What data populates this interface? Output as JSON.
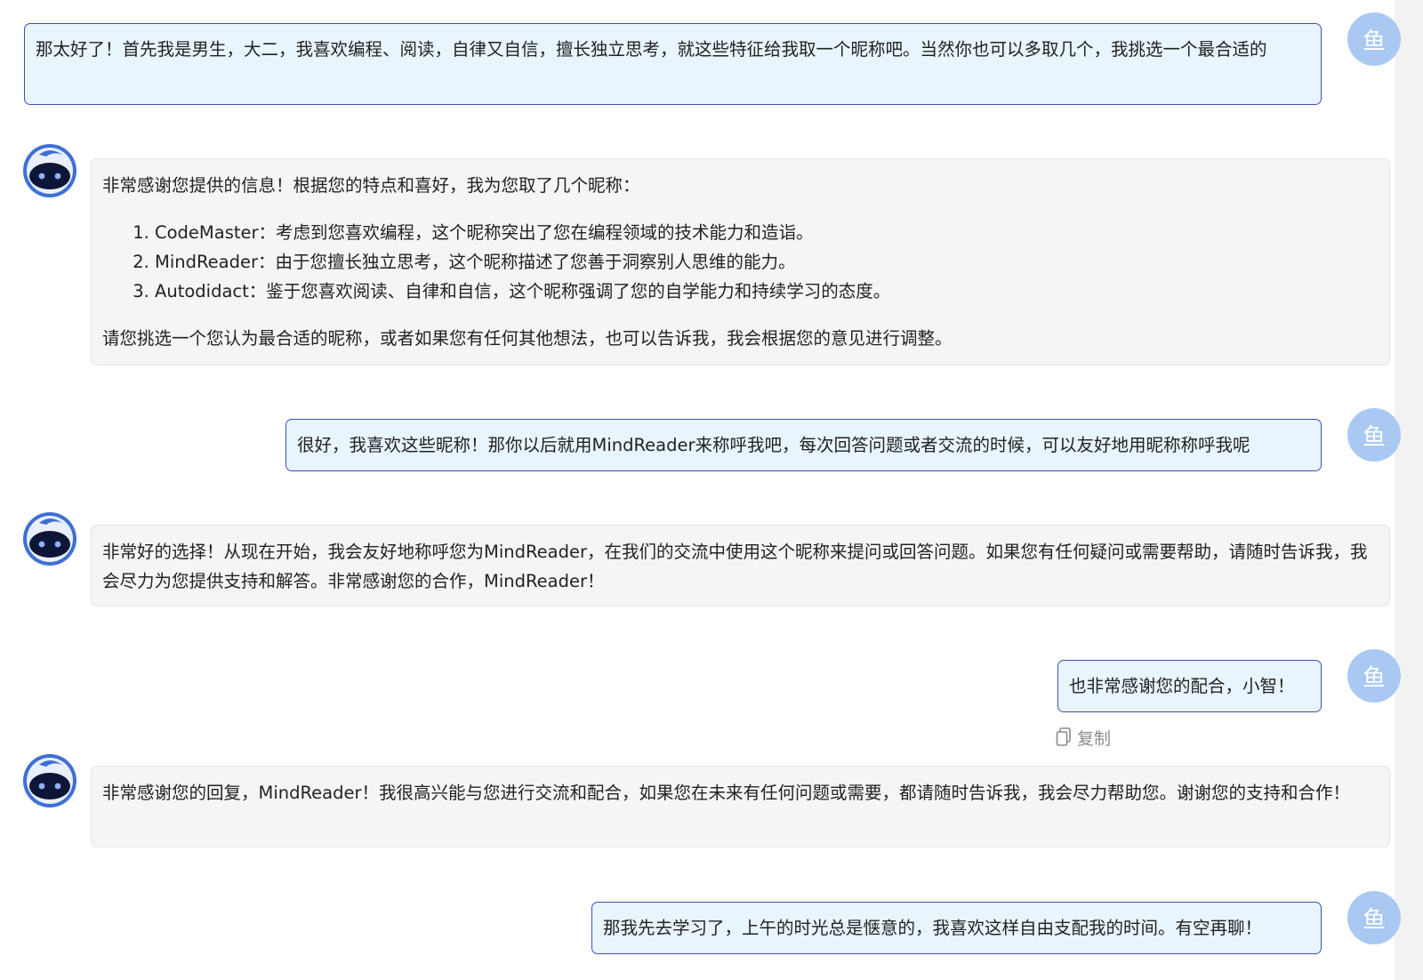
{
  "user_avatar_char": "鱼",
  "messages": {
    "u1": "那太好了！首先我是男生，大二，我喜欢编程、阅读，自律又自信，擅长独立思考，就这些特征给我取一个昵称吧。当然你也可以多取几个，我挑选一个最合适的",
    "b1": {
      "intro": "非常感谢您提供的信息！根据您的特点和喜好，我为您取了几个昵称：",
      "items": [
        "CodeMaster：考虑到您喜欢编程，这个昵称突出了您在编程领域的技术能力和造诣。",
        "MindReader：由于您擅长独立思考，这个昵称描述了您善于洞察别人思维的能力。",
        "Autodidact：鉴于您喜欢阅读、自律和自信，这个昵称强调了您的自学能力和持续学习的态度。"
      ],
      "outro": "请您挑选一个您认为最合适的昵称，或者如果您有任何其他想法，也可以告诉我，我会根据您的意见进行调整。"
    },
    "u2": "很好，我喜欢这些昵称！那你以后就用MindReader来称呼我吧，每次回答问题或者交流的时候，可以友好地用昵称称呼我呢",
    "b2": "非常好的选择！从现在开始，我会友好地称呼您为MindReader，在我们的交流中使用这个昵称来提问或回答问题。如果您有任何疑问或需要帮助，请随时告诉我，我会尽力为您提供支持和解答。非常感谢您的合作，MindReader！",
    "u3": "也非常感谢您的配合，小智！",
    "copy_label": "复制",
    "b3": "非常感谢您的回复，MindReader！我很高兴能与您进行交流和配合，如果您在未来有任何问题或需要，都请随时告诉我，我会尽力帮助您。谢谢您的支持和合作！",
    "u4": "那我先去学习了，上午的时光总是惬意的，我喜欢这样自由支配我的时间。有空再聊！"
  },
  "icons": {
    "bot_avatar": "robot-face-icon",
    "copy": "copy-icon"
  },
  "colors": {
    "user_bubble_bg": "#e8f5fd",
    "user_bubble_border": "#3d4fb8",
    "bot_bubble_bg": "#f4f5f7",
    "user_avatar_bg": "#a9c9f3"
  }
}
